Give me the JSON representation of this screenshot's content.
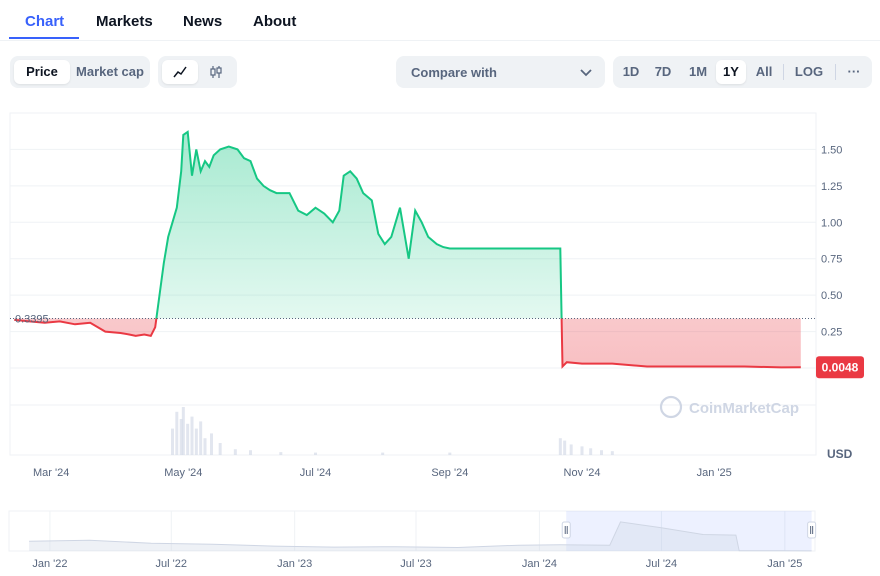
{
  "tabs": [
    {
      "label": "Chart",
      "active": true
    },
    {
      "label": "Markets",
      "active": false
    },
    {
      "label": "News",
      "active": false
    },
    {
      "label": "About",
      "active": false
    }
  ],
  "toolbar": {
    "mode_buttons": [
      {
        "label": "Price",
        "active": true
      },
      {
        "label": "Market cap",
        "active": false
      }
    ],
    "chart_style_icons": [
      {
        "icon": "line-chart-icon",
        "active": true
      },
      {
        "icon": "candlestick-icon",
        "active": false
      }
    ],
    "compare_label": "Compare with",
    "compare_icon": "chevron-down-icon",
    "ranges": [
      {
        "label": "1D",
        "active": false
      },
      {
        "label": "7D",
        "active": false
      },
      {
        "label": "1M",
        "active": false
      },
      {
        "label": "1Y",
        "active": true
      },
      {
        "label": "All",
        "active": false
      }
    ],
    "log_label": "LOG",
    "more_label": "···"
  },
  "colors": {
    "accent": "#3861fb",
    "up": "#16c784",
    "down": "#ea3943"
  },
  "watermark": "CoinMarketCap",
  "chart_data": [
    {
      "type": "area",
      "y_axis": {
        "ticks": [
          0.25,
          0.5,
          0.75,
          1.0,
          1.25,
          1.5
        ],
        "tick_labels": [
          "0.25",
          "0.50",
          "0.75",
          "1.00",
          "1.25",
          "1.50"
        ],
        "range": [
          0,
          1.75
        ],
        "side": "right",
        "unit_label": "USD"
      },
      "x_axis": {
        "tick_labels": [
          "Mar '24",
          "May '24",
          "Jul '24",
          "Sep '24",
          "Nov '24",
          "Jan '25"
        ]
      },
      "baseline": {
        "value": 0.3395,
        "label": "0.3395",
        "style": "dotted"
      },
      "current": {
        "value": 0.0048,
        "label": "0.0048"
      },
      "above_baseline_color": "#16c784",
      "below_baseline_color": "#ea3943",
      "series": [
        {
          "x": [
            "2024-02-13",
            "2024-02-20",
            "2024-02-27",
            "2024-03-05",
            "2024-03-12",
            "2024-03-19",
            "2024-03-26",
            "2024-04-02",
            "2024-04-06",
            "2024-04-09",
            "2024-04-13",
            "2024-04-16",
            "2024-04-18",
            "2024-04-20",
            "2024-04-22",
            "2024-04-24",
            "2024-04-26",
            "2024-04-28",
            "2024-04-30",
            "2024-05-01",
            "2024-05-03",
            "2024-05-05",
            "2024-05-07",
            "2024-05-09",
            "2024-05-11",
            "2024-05-13",
            "2024-05-15",
            "2024-05-18",
            "2024-05-22",
            "2024-05-26",
            "2024-05-29",
            "2024-06-01",
            "2024-06-04",
            "2024-06-07",
            "2024-06-10",
            "2024-06-13",
            "2024-06-16",
            "2024-06-19",
            "2024-06-23",
            "2024-06-27",
            "2024-07-01",
            "2024-07-05",
            "2024-07-09",
            "2024-07-12",
            "2024-07-14",
            "2024-07-17",
            "2024-07-20",
            "2024-07-23",
            "2024-07-27",
            "2024-07-30",
            "2024-08-02",
            "2024-08-05",
            "2024-08-09",
            "2024-08-13",
            "2024-08-16",
            "2024-08-19",
            "2024-08-22",
            "2024-08-26",
            "2024-08-29",
            "2024-09-01",
            "2024-09-03",
            "2024-09-05",
            "2024-09-07",
            "2024-09-09",
            "2024-09-11",
            "2024-09-15",
            "2024-09-19",
            "2024-09-24",
            "2024-10-01",
            "2024-10-10",
            "2024-10-18",
            "2024-10-22",
            "2024-10-23",
            "2024-10-25",
            "2024-11-01",
            "2024-11-15",
            "2024-12-01",
            "2024-12-15",
            "2025-01-01",
            "2025-01-15",
            "2025-02-01",
            "2025-02-10"
          ],
          "values": [
            0.33,
            0.32,
            0.31,
            0.32,
            0.3,
            0.31,
            0.25,
            0.24,
            0.23,
            0.22,
            0.23,
            0.22,
            0.28,
            0.5,
            0.72,
            0.9,
            1.0,
            1.1,
            1.35,
            1.6,
            1.62,
            1.32,
            1.5,
            1.35,
            1.42,
            1.38,
            1.46,
            1.5,
            1.52,
            1.5,
            1.44,
            1.42,
            1.3,
            1.25,
            1.22,
            1.2,
            1.2,
            1.2,
            1.08,
            1.05,
            1.1,
            1.06,
            1.0,
            1.08,
            1.32,
            1.35,
            1.3,
            1.2,
            1.15,
            0.92,
            0.85,
            0.9,
            1.1,
            0.75,
            1.08,
            1.0,
            0.9,
            0.85,
            0.83,
            0.82,
            0.82,
            0.82,
            0.82,
            0.82,
            0.82,
            0.82,
            0.82,
            0.82,
            0.82,
            0.82,
            0.82,
            0.82,
            0.01,
            0.04,
            0.03,
            0.03,
            0.01,
            0.01,
            0.01,
            0.01,
            0.004,
            0.0048
          ]
        }
      ],
      "volume": {
        "x": [
          "2024-04-26",
          "2024-04-28",
          "2024-04-30",
          "2024-05-01",
          "2024-05-03",
          "2024-05-05",
          "2024-05-07",
          "2024-05-09",
          "2024-05-11",
          "2024-05-14",
          "2024-05-18",
          "2024-05-25",
          "2024-06-01",
          "2024-06-15",
          "2024-07-01",
          "2024-08-01",
          "2024-09-01",
          "2024-10-22",
          "2024-10-24",
          "2024-10-27",
          "2024-11-01",
          "2024-11-05",
          "2024-11-10",
          "2024-11-15"
        ],
        "values": [
          0.55,
          0.9,
          0.75,
          1.0,
          0.65,
          0.8,
          0.55,
          0.7,
          0.35,
          0.45,
          0.25,
          0.12,
          0.1,
          0.06,
          0.05,
          0.05,
          0.05,
          0.35,
          0.3,
          0.22,
          0.18,
          0.14,
          0.1,
          0.08
        ]
      }
    },
    {
      "type": "area",
      "role": "range-navigator",
      "x_axis": {
        "tick_labels": [
          "Jan '22",
          "Jul '22",
          "Jan '23",
          "Jul '23",
          "Jan '24",
          "Jul '24",
          "Jan '25"
        ]
      },
      "selected_range": [
        "2024-02-10",
        "2025-02-10"
      ],
      "series": [
        {
          "x": [
            "2021-12-01",
            "2022-03-01",
            "2022-06-01",
            "2022-09-01",
            "2022-12-01",
            "2023-03-01",
            "2023-06-01",
            "2023-09-01",
            "2023-12-01",
            "2024-02-01",
            "2024-04-15",
            "2024-05-01",
            "2024-07-01",
            "2024-09-01",
            "2024-10-20",
            "2024-10-25",
            "2025-01-01",
            "2025-02-10"
          ],
          "values": [
            0.5,
            0.55,
            0.4,
            0.35,
            0.25,
            0.2,
            0.22,
            0.18,
            0.3,
            0.32,
            0.3,
            1.5,
            1.2,
            0.85,
            0.82,
            0.01,
            0.01,
            0.005
          ]
        }
      ]
    }
  ]
}
